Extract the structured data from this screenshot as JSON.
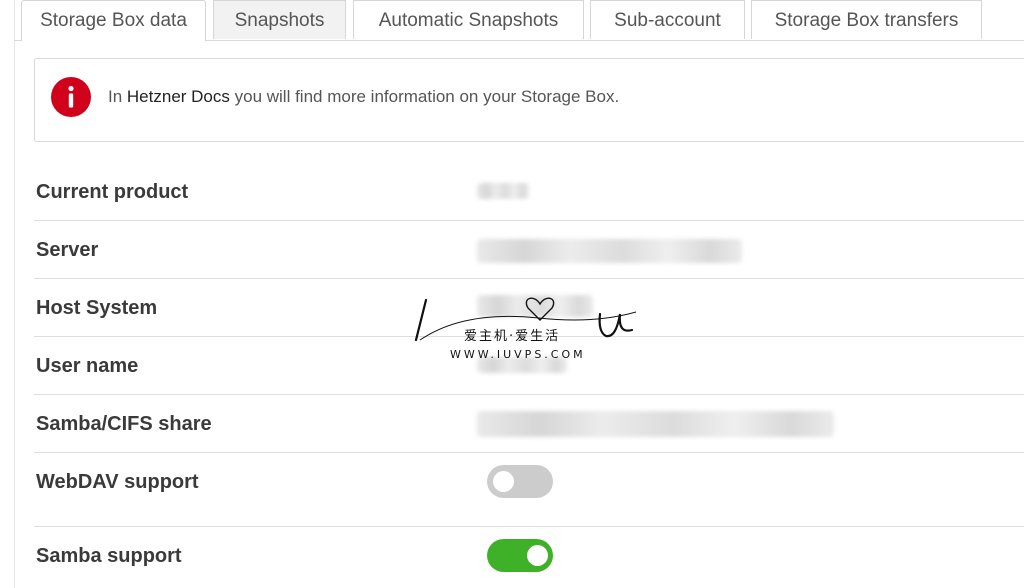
{
  "tabs": [
    {
      "label": "Storage Box data",
      "active": true
    },
    {
      "label": "Snapshots",
      "active": false
    },
    {
      "label": "Automatic Snapshots",
      "active": false
    },
    {
      "label": "Sub-account",
      "active": false
    },
    {
      "label": "Storage Box transfers",
      "active": false
    }
  ],
  "info": {
    "icon": "info-icon",
    "prefix": "In ",
    "link_text": "Hetzner Docs",
    "suffix": " you will find more information on your Storage Box.",
    "icon_color": "#d0021b"
  },
  "details": [
    {
      "label": "Current product"
    },
    {
      "label": "Server"
    },
    {
      "label": "Host System"
    },
    {
      "label": "User name"
    },
    {
      "label": "Samba/CIFS share"
    }
  ],
  "toggles": [
    {
      "label": "WebDAV support",
      "enabled": false
    },
    {
      "label": "Samba support",
      "enabled": true
    }
  ],
  "watermark": {
    "chinese": "爱主机·爱生活",
    "url": "WWW.IUVPS.COM"
  },
  "colors": {
    "toggle_on": "#3fb128",
    "toggle_off": "#cccccc"
  }
}
